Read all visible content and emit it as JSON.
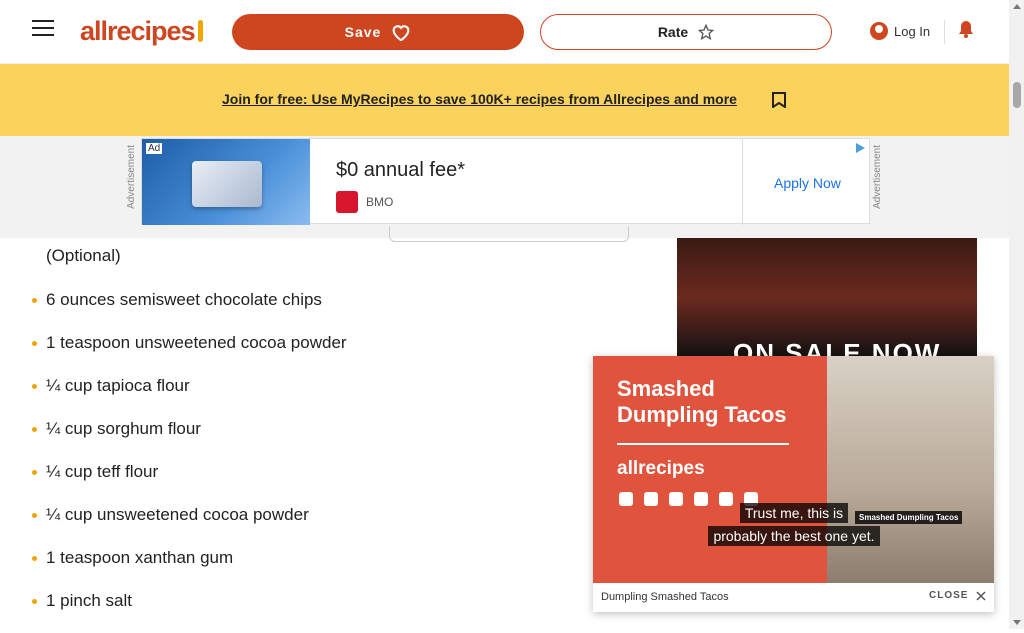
{
  "header": {
    "logo_text": "allrecipes",
    "save_label": "Save",
    "rate_label": "Rate",
    "login_label": "Log In"
  },
  "banner": {
    "text": "Join for free: Use MyRecipes to save 100K+ recipes from Allrecipes and more"
  },
  "ad": {
    "side_label": "Advertisement",
    "tag": "Ad",
    "headline": "$0 annual fee*",
    "brand": "BMO",
    "cta": "Apply Now"
  },
  "ingredients": {
    "partial_text": "(Optional)",
    "items": [
      "6 ounces semisweet chocolate chips",
      "1 teaspoon unsweetened cocoa powder",
      "¼ cup tapioca flour",
      "¼ cup sorghum flour",
      "¼ cup teff flour",
      "¼ cup unsweetened cocoa powder",
      "1 teaspoon xanthan gum",
      "1 pinch salt"
    ]
  },
  "side_ad": {
    "text": "ON SALE NOW"
  },
  "video": {
    "title": "Smashed Dumpling Tacos",
    "logo_text": "allrecipes",
    "caption_line1": "Trust me, this is",
    "caption_line2": "probably the best one yet.",
    "mini_tag": "Smashed Dumpling Tacos",
    "name": "Dumpling Smashed Tacos",
    "close_label": "CLOSE"
  },
  "colors": {
    "brand": "#ce4620",
    "banner": "#fbd25c",
    "bullet": "#f0a500",
    "video_bg": "#e0533c"
  }
}
